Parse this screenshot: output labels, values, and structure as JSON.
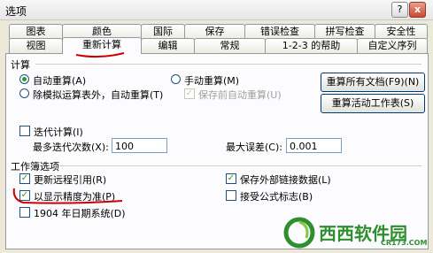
{
  "window": {
    "title": "选项",
    "help_label": "?",
    "close_label": "x"
  },
  "tabs_row1": [
    "图表",
    "颜色",
    "国际",
    "保存",
    "错误检查",
    "拼写检查",
    "安全性"
  ],
  "tabs_row2": [
    "视图",
    "重新计算",
    "编辑",
    "常规",
    "1-2-3 的帮助",
    "自定义序列"
  ],
  "active_tab": "重新计算",
  "calc": {
    "section_label": "计算",
    "auto": "自动重算(A)",
    "auto_except_tables": "除模拟运算表外，自动重算(T)",
    "manual": "手动重算(M)",
    "recalc_before_save": "保存前自动重算(U)",
    "recalc_all_button": "重算所有文档(F9)(N)",
    "recalc_sheet_button": "重算活动工作表(S)",
    "selected": "auto"
  },
  "iteration": {
    "checkbox": "迭代计算(I)",
    "checked": false,
    "max_iter_label": "最多迭代次数(X):",
    "max_iter_value": "100",
    "max_change_label": "最大误差(C):",
    "max_change_value": "0.001"
  },
  "workbook": {
    "section_label": "工作簿选项",
    "update_remote": "更新远程引用(R)",
    "update_remote_checked": true,
    "precision_as_displayed": "以显示精度为准(P)",
    "precision_checked": true,
    "date1904": "1904 年日期系统(D)",
    "date1904_checked": false,
    "save_external": "保存外部链接数据(L)",
    "save_external_checked": true,
    "accept_labels": "接受公式标志(B)",
    "accept_labels_checked": false
  },
  "watermark": {
    "brand": "西西软件园",
    "site": "CR173.COM",
    "brand_color": "#2f8f2f"
  },
  "colors": {
    "annotation": "#cc0000",
    "check": "#21a121"
  }
}
